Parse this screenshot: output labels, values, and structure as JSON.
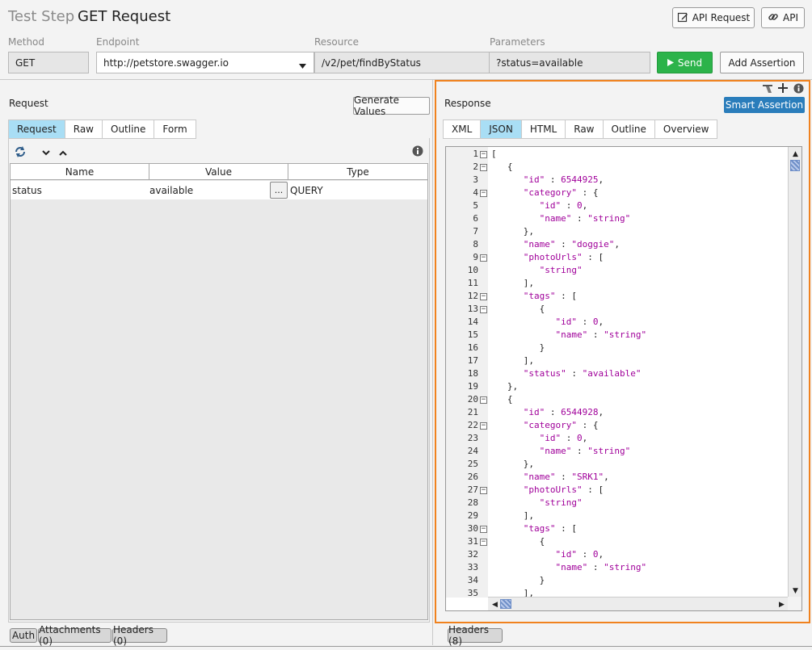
{
  "header": {
    "title_prefix": "Test Step",
    "title": "GET Request",
    "buttons": {
      "api_request": "API Request",
      "api": "API"
    }
  },
  "request_bar": {
    "method_label": "Method",
    "method": "GET",
    "endpoint_label": "Endpoint",
    "endpoint": "http://petstore.swagger.io",
    "resource_label": "Resource",
    "resource": "/v2/pet/findByStatus",
    "parameters_label": "Parameters",
    "parameters": "?status=available",
    "send": "Send",
    "add_assertion": "Add Assertion"
  },
  "request_panel": {
    "title": "Request",
    "generate_values": "Generate Values",
    "tabs": [
      "Request",
      "Raw",
      "Outline",
      "Form"
    ],
    "active_tab": "Request",
    "columns": [
      "Name",
      "Value",
      "Type"
    ],
    "rows": [
      {
        "name": "status",
        "value": "available",
        "type": "QUERY"
      }
    ],
    "ellipsis": "..."
  },
  "response_panel": {
    "title": "Response",
    "smart_assertion": "Smart Assertion",
    "tabs": [
      "XML",
      "JSON",
      "HTML",
      "Raw",
      "Outline",
      "Overview"
    ],
    "active_tab": "JSON",
    "lines": [
      {
        "n": "1",
        "text": "[",
        "fold": true
      },
      {
        "n": "2",
        "text": "   {",
        "fold": true
      },
      {
        "n": "3",
        "text": "      \"id\" : 6544925,",
        "fold": false
      },
      {
        "n": "4",
        "text": "      \"category\" : {",
        "fold": true
      },
      {
        "n": "5",
        "text": "         \"id\" : 0,",
        "fold": false
      },
      {
        "n": "6",
        "text": "         \"name\" : \"string\"",
        "fold": false
      },
      {
        "n": "7",
        "text": "      },",
        "fold": false
      },
      {
        "n": "8",
        "text": "      \"name\" : \"doggie\",",
        "fold": false
      },
      {
        "n": "9",
        "text": "      \"photoUrls\" : [",
        "fold": true
      },
      {
        "n": "10",
        "text": "         \"string\"",
        "fold": false
      },
      {
        "n": "11",
        "text": "      ],",
        "fold": false
      },
      {
        "n": "12",
        "text": "      \"tags\" : [",
        "fold": true
      },
      {
        "n": "13",
        "text": "         {",
        "fold": true
      },
      {
        "n": "14",
        "text": "            \"id\" : 0,",
        "fold": false
      },
      {
        "n": "15",
        "text": "            \"name\" : \"string\"",
        "fold": false
      },
      {
        "n": "16",
        "text": "         }",
        "fold": false
      },
      {
        "n": "17",
        "text": "      ],",
        "fold": false
      },
      {
        "n": "18",
        "text": "      \"status\" : \"available\"",
        "fold": false
      },
      {
        "n": "19",
        "text": "   },",
        "fold": false
      },
      {
        "n": "20",
        "text": "   {",
        "fold": true
      },
      {
        "n": "21",
        "text": "      \"id\" : 6544928,",
        "fold": false
      },
      {
        "n": "22",
        "text": "      \"category\" : {",
        "fold": true
      },
      {
        "n": "23",
        "text": "         \"id\" : 0,",
        "fold": false
      },
      {
        "n": "24",
        "text": "         \"name\" : \"string\"",
        "fold": false
      },
      {
        "n": "25",
        "text": "      },",
        "fold": false
      },
      {
        "n": "26",
        "text": "      \"name\" : \"SRK1\",",
        "fold": false
      },
      {
        "n": "27",
        "text": "      \"photoUrls\" : [",
        "fold": true
      },
      {
        "n": "28",
        "text": "         \"string\"",
        "fold": false
      },
      {
        "n": "29",
        "text": "      ],",
        "fold": false
      },
      {
        "n": "30",
        "text": "      \"tags\" : [",
        "fold": true
      },
      {
        "n": "31",
        "text": "         {",
        "fold": true
      },
      {
        "n": "32",
        "text": "            \"id\" : 0,",
        "fold": false
      },
      {
        "n": "33",
        "text": "            \"name\" : \"string\"",
        "fold": false
      },
      {
        "n": "34",
        "text": "         }",
        "fold": false
      },
      {
        "n": "35",
        "text": "      ],",
        "fold": false
      }
    ]
  },
  "bottom_left_tabs": [
    "Auth",
    "Attachments (0)",
    "Headers (0)"
  ],
  "bottom_right_tabs": [
    "Headers (8)"
  ],
  "icons": {
    "refresh": "refresh-icon",
    "expand": "chevron-down-icon",
    "collapse": "chevron-up-icon",
    "info": "info-icon",
    "play": "play-icon",
    "add": "plus-icon",
    "toolbar": "settings-icon"
  },
  "colors": {
    "accent_tab": "#a9def5",
    "send": "#2cb34a",
    "smart_assertion": "#2a7dbb",
    "highlight_frame": "#f0821e",
    "json_token": "#a0009a"
  }
}
